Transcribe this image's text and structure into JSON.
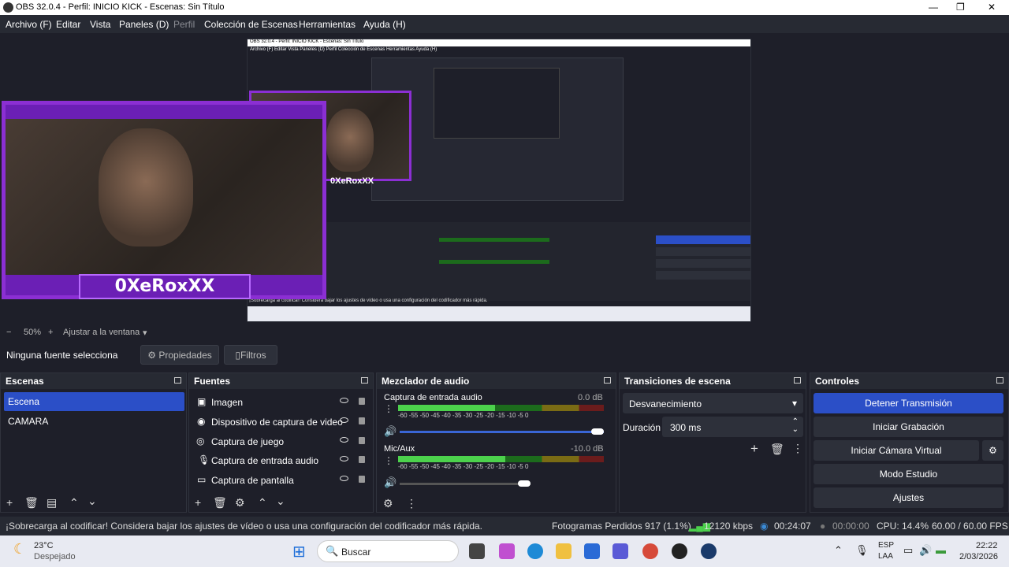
{
  "window": {
    "title": "OBS 32.0.4 - Perfil: INICIO KICK - Escenas: Sin Título"
  },
  "menu": [
    "Archivo (F)",
    "Editar",
    "Vista",
    "Paneles (D)",
    "Perfil",
    "Colección de Escenas",
    "Herramientas",
    "Ayuda (H)"
  ],
  "preview": {
    "banner_text": "0XeRoxXX"
  },
  "nested": {
    "title": "OBS 32.0.4 - Perfil: INICIO KICK - Escenas: Sin Título",
    "menu": "Archivo (F)   Editar   Vista   Paneles (D)   Perfil   Colección de Escenas   Herramientas   Ayuda (H)",
    "banner_text": "0XeRoxXX",
    "status": "¡Sobrecarga al codificar! Considera bajar los ajustes de vídeo o usa una configuración del codificador más rápida."
  },
  "zoom": {
    "minus": "−",
    "value": "50%",
    "plus": "+",
    "fit": "Ajustar a la ventana"
  },
  "sourcebar": {
    "label": "Ninguna fuente selecciona",
    "props": "Propiedades",
    "filters": "Filtros"
  },
  "scenes": {
    "title": "Escenas",
    "items": [
      "Escena",
      "CAMARA"
    ]
  },
  "sources": {
    "title": "Fuentes",
    "items": [
      "Imagen",
      "Dispositivo de captura de video",
      "Captura de juego",
      "Captura de entrada audio",
      "Captura de pantalla"
    ]
  },
  "mixer": {
    "title": "Mezclador de audio",
    "channels": [
      {
        "name": "Captura de entrada audio",
        "db": "0.0 dB",
        "level": 0.47,
        "volume": 1.0
      },
      {
        "name": "Mic/Aux",
        "db": "-10.0 dB",
        "level": 0.52,
        "volume": 0.64
      }
    ],
    "ticks": "-60  -55  -50  -45  -40  -35  -30  -25  -20  -15  -10   -5    0"
  },
  "transitions": {
    "title": "Transiciones de escena",
    "type": "Desvanecimiento",
    "duration_label": "Duración",
    "duration": "300 ms"
  },
  "controls": {
    "title": "Controles",
    "stop_stream": "Detener Transmisión",
    "start_rec": "Iniciar Grabación",
    "start_vcam": "Iniciar Cámara Virtual",
    "studio": "Modo Estudio",
    "settings": "Ajustes"
  },
  "status": {
    "warning": "¡Sobrecarga al codificar! Considera bajar los ajustes de vídeo o usa una configuración del codificador más rápida.",
    "dropped": "Fotogramas Perdidos 917 (1.1%)",
    "bitrate": "12120 kbps",
    "stream_time": "00:24:07",
    "rec_time": "00:00:00",
    "cpu": "CPU: 14.4%",
    "fps": "60.00 / 60.00 FPS"
  },
  "taskbar": {
    "temp": "23°C",
    "weather": "Despejado",
    "search": "Buscar",
    "lang1": "ESP",
    "lang2": "LAA",
    "time": "22:22",
    "date": "2/03/2026"
  },
  "colors": {
    "accent": "#3a66d6",
    "stream_button": "#2b4fc7",
    "banner": "#6b1fb5"
  }
}
